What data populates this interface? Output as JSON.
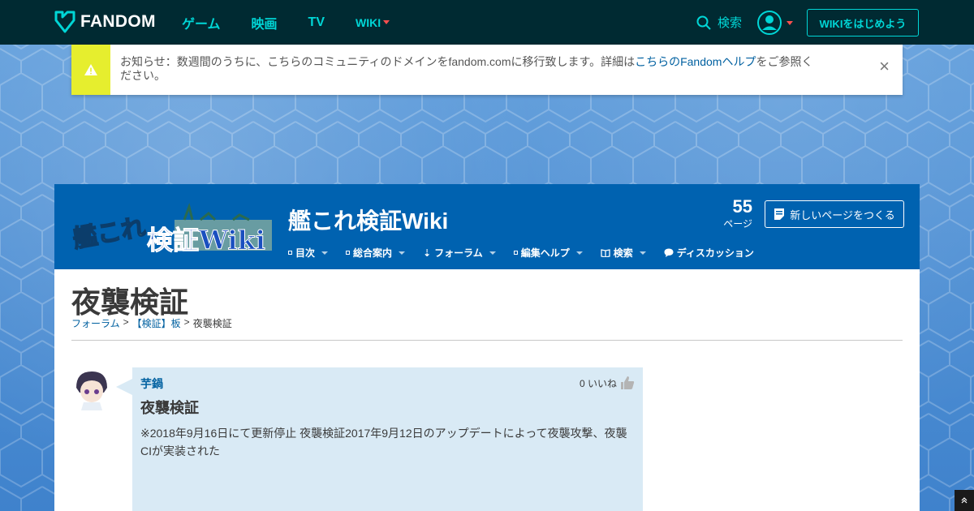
{
  "global_nav": {
    "brand": "FANDOM",
    "links": [
      "ゲーム",
      "映画",
      "TV"
    ],
    "wiki_label": "WIKI",
    "search_label": "検索",
    "start_wiki_label": "WIKIをはじめよう"
  },
  "notice": {
    "text_prefix": "お知らせ：数週間のうちに、こちらのコミュニティのドメインをfandom.comに移行致します。詳細は",
    "link_text": "こちらのFandomヘルプ",
    "text_suffix": "をご参照ください。",
    "close_label": "×"
  },
  "wiki_header": {
    "wordmark_line1": "艦これ",
    "wordmark_line2": "検証Wiki",
    "wiki_name": "艦これ検証Wiki",
    "page_count": "55",
    "page_count_label": "ページ",
    "new_page_label": "新しいページをつくる",
    "nav": [
      {
        "label": "目次"
      },
      {
        "label": "総合案内"
      },
      {
        "label": "フォーラム"
      },
      {
        "label": "編集ヘルプ"
      },
      {
        "label": "検索"
      },
      {
        "label": "ディスカッション"
      }
    ]
  },
  "page": {
    "title": "夜襲検証",
    "breadcrumb": [
      "フォーラム",
      "【検証】板",
      "夜襲検証"
    ],
    "breadcrumb_sep": ">"
  },
  "post": {
    "author": "芋鍋",
    "likes": "0 いいね",
    "title": "夜襲検証",
    "body": "※2018年9月16日にて更新停止 夜襲検証2017年9月12日のアップデートによって夜襲攻撃、夜襲CIが実装された"
  },
  "colors": {
    "nav_bg": "#002a32",
    "accent": "#00d6d6",
    "wiki_header_bg": "#0062b0",
    "notice_icon_bg": "#e6ee2e",
    "post_bg": "#d9eaf5",
    "link": "#0060a0"
  }
}
